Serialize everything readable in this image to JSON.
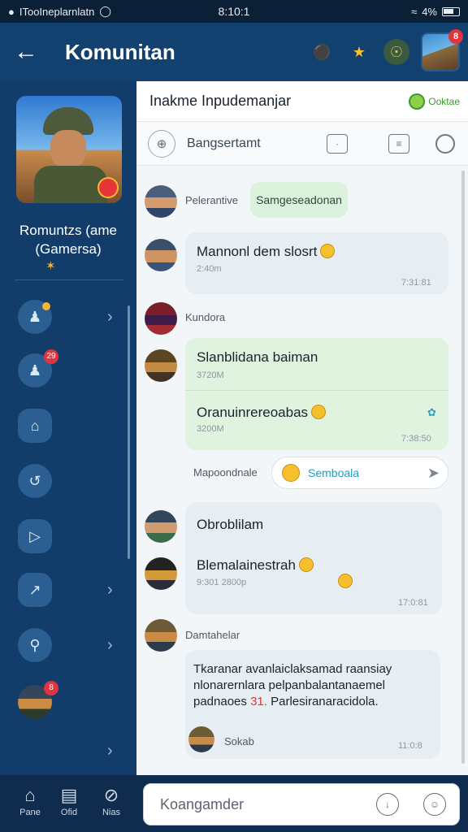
{
  "status": {
    "left_text": "ITooIneplarnlatn",
    "time": "8:10:1",
    "battery": "4%"
  },
  "header": {
    "title": "Komunitan",
    "avatar_badge": "8"
  },
  "sidebar": {
    "game_name_line1": "Romuntzs (ame",
    "game_name_line2": "(Gamersa)",
    "nav_badges": {
      "item2": "29"
    },
    "avatar_badge": "8"
  },
  "main": {
    "header_title": "Inakme Inpudemanjar",
    "online_label": "Ooktae",
    "toolbar_label": "Bangsertamt",
    "messages": [
      {
        "name": "Pelerantive",
        "pill": "Samgeseadonan"
      },
      {
        "text": "Mannonl dem slosrt",
        "time": "2:40m",
        "time_right": "7:31:81"
      },
      {
        "name": "Kundora"
      },
      {
        "text": "Slanblidana baiman",
        "time": "3720M"
      },
      {
        "text": "Oranuinrereoabas",
        "time": "3200M",
        "time_right": "7:38:50"
      },
      {
        "name": "Mapoondnale",
        "reply": "Semboala"
      },
      {
        "text": "Obroblilam"
      },
      {
        "text": "Blemalainestrah",
        "time": "9:301 2800p",
        "time_right": "17:0:81"
      },
      {
        "name": "Damtahelar"
      },
      {
        "text_line1": "Tkaranar avanlaiclaksamad raansiay",
        "text_line2": "nlonarernlara pelpanbalantanaemel",
        "text_line3_a": "padnaoes",
        "text_line3_b": "31.",
        "text_line3_c": "Parlesiranaracidola.",
        "sender": "Sokab",
        "time_right": "11:0:8"
      }
    ]
  },
  "bottom": {
    "nav": [
      {
        "label": "Pane"
      },
      {
        "label": "Ofid"
      },
      {
        "label": "Nias"
      }
    ],
    "compose_placeholder": "Koangamder"
  }
}
